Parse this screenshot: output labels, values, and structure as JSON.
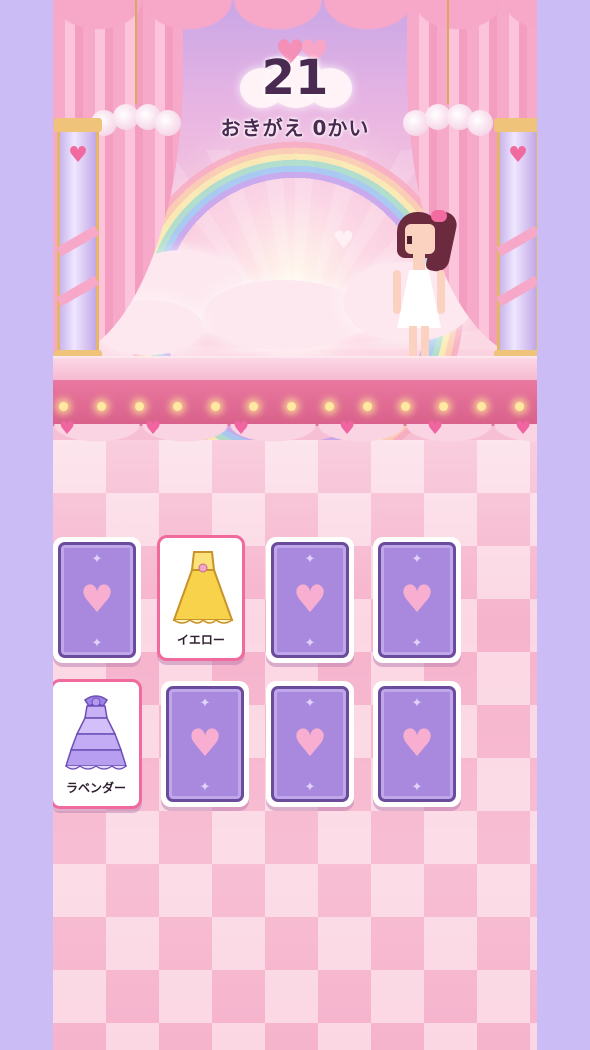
{
  "hud": {
    "counter": "21",
    "changes_label": "おきがえ 0かい"
  },
  "cards": [
    {
      "row": 1,
      "col": 1,
      "state": "face-down"
    },
    {
      "row": 1,
      "col": 2,
      "state": "face-up",
      "item": "yellow-dress",
      "label": "イエロー",
      "color": "#f7d24a"
    },
    {
      "row": 1,
      "col": 3,
      "state": "face-down"
    },
    {
      "row": 1,
      "col": 4,
      "state": "face-down"
    },
    {
      "row": 2,
      "col": 1,
      "state": "face-up",
      "item": "lavender-dress",
      "label": "ラベンダー",
      "color": "#b9a2f0"
    },
    {
      "row": 2,
      "col": 2,
      "state": "face-down"
    },
    {
      "row": 2,
      "col": 3,
      "state": "face-down"
    },
    {
      "row": 2,
      "col": 4,
      "state": "face-down"
    }
  ],
  "colors": {
    "side_background": "#cbbcf5",
    "card_back": "#a889de",
    "card_front_border": "#f06a9e",
    "text_dark": "#4b2a52"
  }
}
